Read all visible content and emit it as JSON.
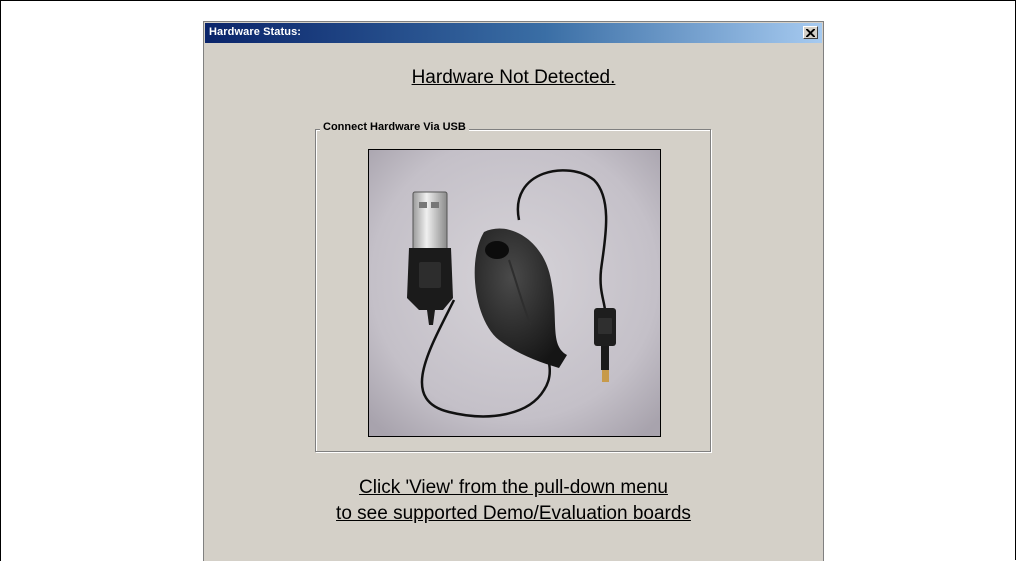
{
  "window": {
    "title": "Hardware Status:",
    "close_icon": "close-x-icon"
  },
  "main": {
    "heading": "Hardware Not Detected.",
    "group_label": "Connect Hardware Via USB",
    "photo_subject": "usb-retractable-cable-photo",
    "instruction_line1": "Click 'View' from the pull-down menu ",
    "instruction_line2": "to see supported Demo/Evaluation boards"
  },
  "colors": {
    "window_bg": "#d4d0c8",
    "titlebar_start": "#0a246a",
    "titlebar_end": "#a6caf0"
  }
}
